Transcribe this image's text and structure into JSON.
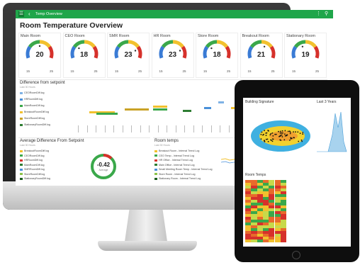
{
  "app": {
    "title": "Temp Overview"
  },
  "dashboard": {
    "title": "Room Temperature Overview"
  },
  "gauges": [
    {
      "name": "Main Room",
      "value": "20",
      "min": "15",
      "max": "25",
      "level": 0.5
    },
    {
      "name": "CEO Room",
      "value": "18",
      "min": "15",
      "max": "25",
      "level": 0.3
    },
    {
      "name": "SMR Room",
      "value": "23",
      "min": "15",
      "max": "25",
      "level": 0.8
    },
    {
      "name": "HR Room",
      "value": "23",
      "min": "15",
      "max": "25",
      "level": 0.8
    },
    {
      "name": "Store Room",
      "value": "18",
      "min": "15",
      "max": "25",
      "level": 0.3
    },
    {
      "name": "Breakout Room",
      "value": "21",
      "min": "15",
      "max": "25",
      "level": 0.6
    },
    {
      "name": "Stationary Room",
      "value": "19",
      "min": "15",
      "max": "25",
      "level": 0.4
    }
  ],
  "colors": {
    "brand_green": "#1fa64a",
    "gauge_red": "#d6312b",
    "gauge_yellow": "#f2c12e",
    "gauge_green": "#3aa84a",
    "gauge_blue": "#3a7bd5"
  },
  "setpoint": {
    "title": "Difference from setpoint",
    "subtitle": "Last 30 Hours",
    "legend": [
      {
        "label": "CEORoomDiff.log",
        "color": "#7fb2e5"
      },
      {
        "label": "HRRoomDiff.log",
        "color": "#4a90d9"
      },
      {
        "label": "MainRoomDiff.log",
        "color": "#3aa84a"
      },
      {
        "label": "BreakoutRoomDiff.log",
        "color": "#f2c12e"
      },
      {
        "label": "StoreRoomDiff.log",
        "color": "#c9a227"
      },
      {
        "label": "StationaryRoomDiff.log",
        "color": "#2e7d32"
      }
    ]
  },
  "average": {
    "title": "Average Difference From Setpoint",
    "subtitle": "Last 30 Hours",
    "donut_value": "-0.42",
    "donut_label": "Average",
    "legend": [
      {
        "label": "BreakoutRoomDiff.log",
        "color": "#f2c12e"
      },
      {
        "label": "CEORoomDiff.log",
        "color": "#3aa84a"
      },
      {
        "label": "HRRoomDiff.log",
        "color": "#d6312b"
      },
      {
        "label": "MainRoomDiff.log",
        "color": "#2e7d32"
      },
      {
        "label": "SMRRoomDiff.log",
        "color": "#4a90d9"
      },
      {
        "label": "StoreRoomDiff.log",
        "color": "#8bc34a"
      },
      {
        "label": "StationaryRoomDiff.log",
        "color": "#1b5e20"
      }
    ]
  },
  "room_temps": {
    "title": "Room temps",
    "subtitle": "Last 30 Hours",
    "legend": [
      {
        "label": "Breakout Room - Internal Trend Log",
        "color": "#f2c12e"
      },
      {
        "label": "CEO Temp - Internal Trend Log",
        "color": "#3aa84a"
      },
      {
        "label": "HR Office - Internal Trend Log",
        "color": "#d6312b"
      },
      {
        "label": "Main Office - Internal Trend Log",
        "color": "#2e7d32"
      },
      {
        "label": "Small Meeting Room Temp - Internal Trend Log",
        "color": "#4a90d9"
      },
      {
        "label": "Store Room - Internal Trend Log",
        "color": "#8bc34a"
      },
      {
        "label": "Stationary Room - Internal Trend Log",
        "color": "#1b5e20"
      }
    ]
  },
  "tablet": {
    "building_signature": {
      "title": "Building Signature"
    },
    "last_years": {
      "title": "Last 3 Years"
    },
    "room_temps": {
      "title": "Room Temps"
    }
  }
}
